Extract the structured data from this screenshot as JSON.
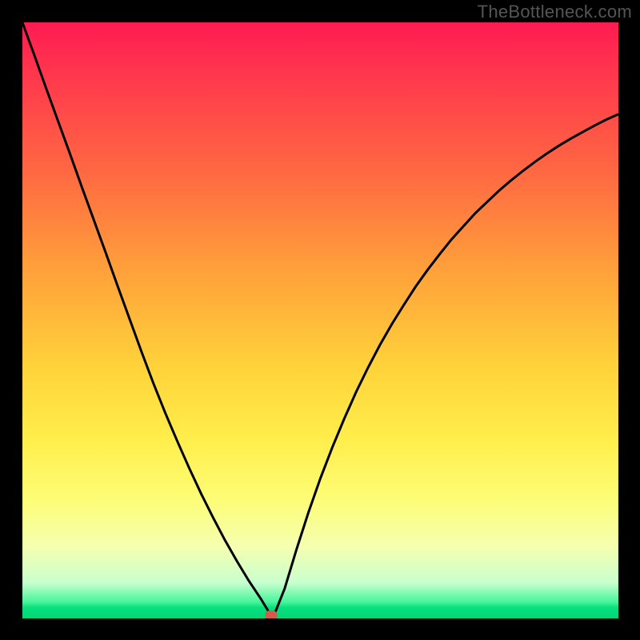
{
  "watermark": "TheBottleneck.com",
  "chart_data": {
    "type": "line",
    "title": "",
    "xlabel": "",
    "ylabel": "",
    "xlim": [
      0,
      1
    ],
    "ylim": [
      0,
      1
    ],
    "x": [
      0.0,
      0.02,
      0.04,
      0.06,
      0.08,
      0.1,
      0.12,
      0.14,
      0.16,
      0.18,
      0.2,
      0.22,
      0.24,
      0.26,
      0.28,
      0.3,
      0.32,
      0.34,
      0.36,
      0.38,
      0.4,
      0.42,
      0.44,
      0.46,
      0.48,
      0.5,
      0.52,
      0.54,
      0.56,
      0.58,
      0.6,
      0.62,
      0.64,
      0.66,
      0.68,
      0.7,
      0.72,
      0.74,
      0.76,
      0.78,
      0.8,
      0.82,
      0.84,
      0.86,
      0.88,
      0.9,
      0.92,
      0.94,
      0.96,
      0.98,
      1.0
    ],
    "values": [
      1.0,
      0.945,
      0.889,
      0.834,
      0.779,
      0.723,
      0.668,
      0.613,
      0.557,
      0.502,
      0.447,
      0.394,
      0.344,
      0.297,
      0.252,
      0.209,
      0.169,
      0.131,
      0.096,
      0.063,
      0.033,
      0.0,
      0.05,
      0.116,
      0.178,
      0.235,
      0.287,
      0.335,
      0.38,
      0.421,
      0.459,
      0.494,
      0.526,
      0.557,
      0.585,
      0.611,
      0.636,
      0.658,
      0.68,
      0.699,
      0.718,
      0.735,
      0.751,
      0.766,
      0.78,
      0.793,
      0.805,
      0.816,
      0.827,
      0.837,
      0.846
    ],
    "marker": {
      "x": 0.418,
      "y": 0.0
    },
    "gradient_stops": [
      {
        "pos": 0.0,
        "color": "#ff1b52"
      },
      {
        "pos": 0.1,
        "color": "#ff3b4c"
      },
      {
        "pos": 0.25,
        "color": "#ff6842"
      },
      {
        "pos": 0.42,
        "color": "#ffa23a"
      },
      {
        "pos": 0.58,
        "color": "#ffd33a"
      },
      {
        "pos": 0.7,
        "color": "#ffee4c"
      },
      {
        "pos": 0.8,
        "color": "#fdfd76"
      },
      {
        "pos": 0.88,
        "color": "#f5ffb0"
      },
      {
        "pos": 0.94,
        "color": "#c8ffcf"
      },
      {
        "pos": 0.972,
        "color": "#49f59c"
      },
      {
        "pos": 0.982,
        "color": "#08e07e"
      },
      {
        "pos": 1.0,
        "color": "#00d878"
      }
    ]
  }
}
